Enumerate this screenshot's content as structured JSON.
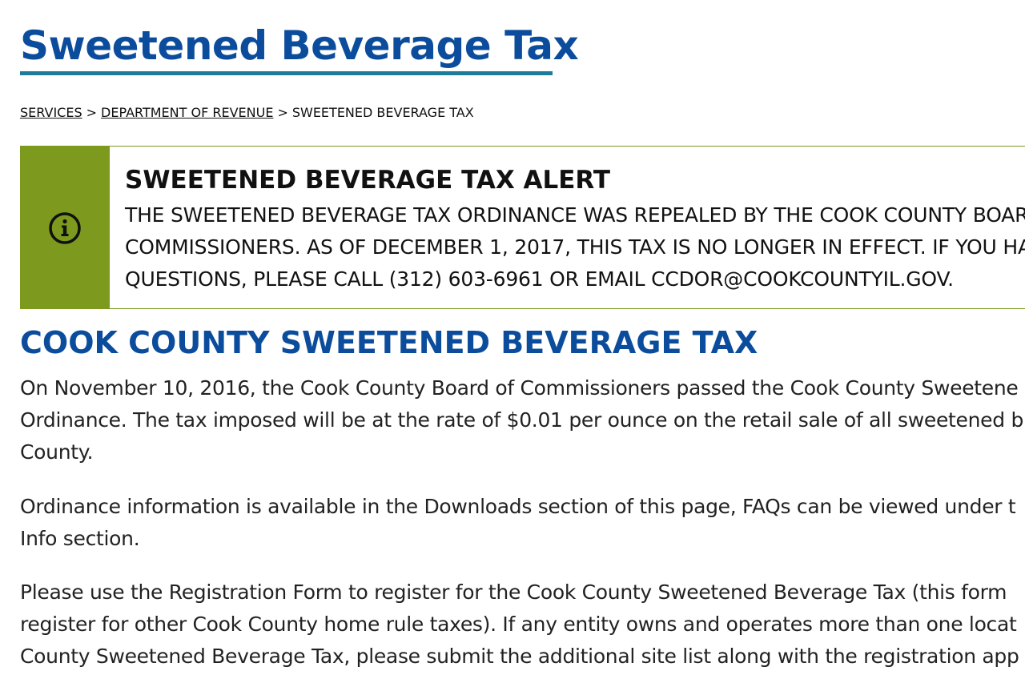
{
  "page": {
    "title": "Sweetened Beverage Tax"
  },
  "breadcrumb": {
    "items": [
      "SERVICES",
      "DEPARTMENT OF REVENUE",
      "SWEETENED BEVERAGE TAX"
    ],
    "separator": ">"
  },
  "alert": {
    "icon": "info-icon",
    "title": "SWEETENED BEVERAGE TAX ALERT",
    "lines": [
      "THE SWEETENED BEVERAGE TAX ORDINANCE WAS REPEALED BY THE COOK COUNTY BOAR",
      "COMMISSIONERS. AS OF DECEMBER 1, 2017, THIS TAX IS NO LONGER IN EFFECT. IF YOU HA",
      "QUESTIONS, PLEASE CALL (312) 603-6961 OR EMAIL CCDOR@COOKCOUNTYIL.GOV."
    ],
    "accent_color": "#7d9a1e"
  },
  "main": {
    "heading": "COOK COUNTY SWEETENED BEVERAGE TAX",
    "paragraphs": [
      {
        "lines": [
          "On November 10, 2016, the Cook County Board of Commissioners passed the Cook County Sweetene",
          "Ordinance. The tax imposed will be at the rate of $0.01 per ounce on the retail sale of all sweetened b",
          "County."
        ]
      },
      {
        "lines": [
          "Ordinance information is available in the Downloads section of this page, FAQs can be viewed under t",
          "Info section."
        ]
      },
      {
        "lines": [
          "Please use the Registration Form to register for the Cook County Sweetened Beverage Tax (this form",
          "register for other Cook County home rule taxes). If any entity owns and operates more than one locat",
          "County Sweetened Beverage Tax, please submit the additional site list along with the registration app"
        ]
      }
    ]
  },
  "colors": {
    "title_blue": "#0b4d9c",
    "title_underline": "#1c7c9a",
    "alert_green": "#7d9a1e"
  }
}
